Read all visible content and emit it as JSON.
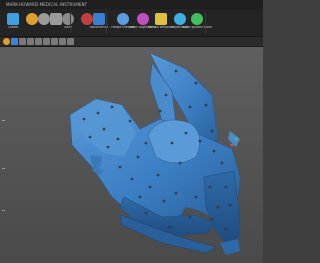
{
  "window": {
    "title": "MARK-HOWARD-MEDICAL-INSTRUMENT"
  },
  "ribbon": {
    "buttons": [
      {
        "name": "create-button",
        "label": "Create",
        "icon": "create-icon",
        "color": "#3fa0e0"
      },
      {
        "name": "open-button",
        "label": "",
        "icon": "open-icon",
        "color": "#e0a030"
      },
      {
        "name": "import-button",
        "label": "",
        "icon": "import-icon",
        "color": "#9a9a9a"
      },
      {
        "name": "export-button",
        "label": "",
        "icon": "export-icon",
        "color": "#9a9a9a"
      },
      {
        "name": "save-button",
        "label": "Save",
        "icon": "save-icon",
        "color": "#8a8a8a"
      },
      {
        "name": "capture-button",
        "label": "",
        "icon": "capture-icon",
        "color": "#c04040"
      },
      {
        "name": "reconstruct-button",
        "label": "Reconstruct",
        "icon": "reconstruct-icon",
        "color": "#3a7fd0"
      },
      {
        "name": "merge-meshes-button",
        "label": "Merge meshes",
        "icon": "merge-icon",
        "color": "#5b9de0"
      },
      {
        "name": "basic-alignments-button",
        "label": "Basic alignments",
        "icon": "align-icon",
        "color": "#c050c0"
      },
      {
        "name": "build-a-template-button",
        "label": "Build a template",
        "icon": "template-icon",
        "color": "#e0c040"
      },
      {
        "name": "export-sub-button",
        "label": "Export sub",
        "icon": "export-sub-icon",
        "color": "#40b0e0"
      },
      {
        "name": "basic-guided-workflow-button",
        "label": "Basic guided workflow",
        "icon": "workflow-icon",
        "color": "#40c060"
      }
    ]
  },
  "toolbar": {
    "items": [
      {
        "name": "snap-toggle",
        "icon": "star-icon",
        "color": "#e0a020"
      },
      {
        "name": "select-tool",
        "icon": "cursor-icon",
        "color": "#4080e0"
      },
      {
        "name": "lasso-tool",
        "icon": "lasso-icon",
        "color": "#7a7a7a"
      },
      {
        "name": "brush-tool",
        "icon": "brush-icon",
        "color": "#7a7a7a"
      },
      {
        "name": "view-tool",
        "icon": "eye-icon",
        "color": "#7a7a7a"
      },
      {
        "name": "grid-tool",
        "icon": "grid-icon",
        "color": "#7a7a7a"
      },
      {
        "name": "measure-tool",
        "icon": "ruler-icon",
        "color": "#7a7a7a"
      },
      {
        "name": "display-tool",
        "icon": "display-icon",
        "color": "#7a7a7a"
      },
      {
        "name": "options-dropdown",
        "icon": "chevron-down-icon",
        "color": "#7a7a7a"
      }
    ]
  },
  "viewport": {
    "model_color": "#3c7fc4",
    "marker_color": "#101a26",
    "background": "#555555"
  }
}
